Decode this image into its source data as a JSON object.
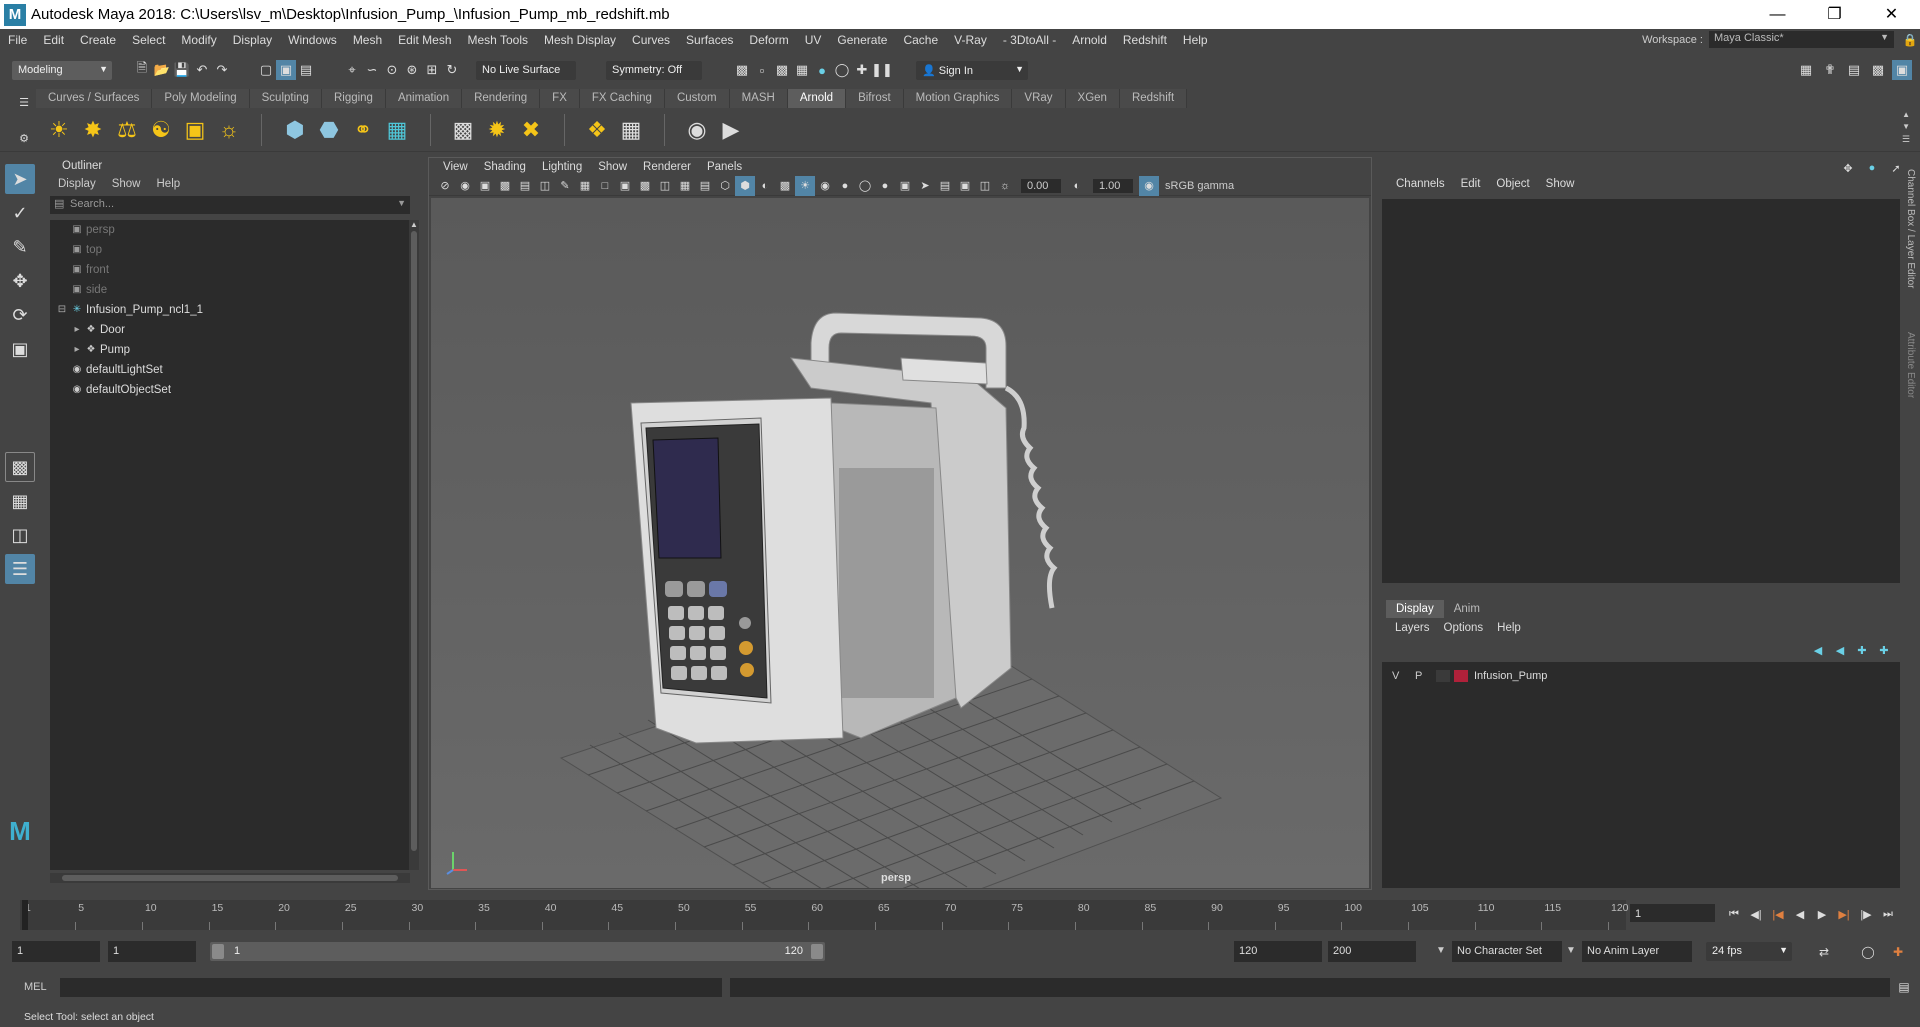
{
  "titlebar": {
    "title": "Autodesk Maya 2018: C:\\Users\\lsv_m\\Desktop\\Infusion_Pump_\\Infusion_Pump_mb_redshift.mb",
    "logo_letter": "M"
  },
  "menubar": {
    "items": [
      "File",
      "Edit",
      "Create",
      "Select",
      "Modify",
      "Display",
      "Windows",
      "Mesh",
      "Edit Mesh",
      "Mesh Tools",
      "Mesh Display",
      "Curves",
      "Surfaces",
      "Deform",
      "UV",
      "Generate",
      "Cache",
      "V-Ray",
      "- 3DtoAll -",
      "Arnold",
      "Redshift",
      "Help"
    ],
    "workspace_label": "Workspace :",
    "workspace_value": "Maya Classic*"
  },
  "statusline": {
    "mode": "Modeling",
    "live_surface": "No Live Surface",
    "symmetry": "Symmetry: Off",
    "sign_in": "Sign In"
  },
  "shelf": {
    "tabs": [
      "Curves / Surfaces",
      "Poly Modeling",
      "Sculpting",
      "Rigging",
      "Animation",
      "Rendering",
      "FX",
      "FX Caching",
      "Custom",
      "MASH",
      "Arnold",
      "Bifrost",
      "Motion Graphics",
      "VRay",
      "XGen",
      "Redshift"
    ],
    "active_tab": "Arnold"
  },
  "outliner": {
    "title": "Outliner",
    "menu": [
      "Display",
      "Show",
      "Help"
    ],
    "search_placeholder": "Search...",
    "items": [
      {
        "label": "persp",
        "dim": true,
        "indent": 1,
        "icon": "camera-icon"
      },
      {
        "label": "top",
        "dim": true,
        "indent": 1,
        "icon": "camera-icon"
      },
      {
        "label": "front",
        "dim": true,
        "indent": 1,
        "icon": "camera-icon"
      },
      {
        "label": "side",
        "dim": true,
        "indent": 1,
        "icon": "camera-icon"
      },
      {
        "label": "Infusion_Pump_ncl1_1",
        "dim": false,
        "indent": 1,
        "icon": "group-icon"
      },
      {
        "label": "Door",
        "dim": false,
        "indent": 2,
        "icon": "transform-icon"
      },
      {
        "label": "Pump",
        "dim": false,
        "indent": 2,
        "icon": "transform-icon"
      },
      {
        "label": "defaultLightSet",
        "dim": false,
        "indent": 1,
        "icon": "set-icon"
      },
      {
        "label": "defaultObjectSet",
        "dim": false,
        "indent": 1,
        "icon": "set-icon"
      }
    ]
  },
  "viewport": {
    "menu": [
      "View",
      "Shading",
      "Lighting",
      "Show",
      "Renderer",
      "Panels"
    ],
    "exposure": "0.00",
    "gamma": "1.00",
    "color_space": "sRGB gamma",
    "camera_label": "persp"
  },
  "channelbox": {
    "menu": [
      "Channels",
      "Edit",
      "Object",
      "Show"
    ],
    "side_tab_1": "Channel Box / Layer Editor",
    "side_tab_2": "Attribute Editor"
  },
  "layereditor": {
    "tabs": [
      "Display",
      "Anim"
    ],
    "active_tab": "Display",
    "menu": [
      "Layers",
      "Options",
      "Help"
    ],
    "layers": [
      {
        "v": "V",
        "p": "P",
        "name": "Infusion_Pump",
        "color": "#b0213a"
      }
    ]
  },
  "timeline": {
    "ticks": [
      "1",
      "5",
      "10",
      "15",
      "20",
      "25",
      "30",
      "35",
      "40",
      "45",
      "50",
      "55",
      "60",
      "65",
      "70",
      "75",
      "80",
      "85",
      "90",
      "95",
      "100",
      "105",
      "110",
      "115",
      "120"
    ],
    "current_frame": "1"
  },
  "range": {
    "start": "1",
    "playback_start": "1",
    "slider_start": "1",
    "slider_end": "120",
    "playback_end": "120",
    "end": "200",
    "character_set": "No Character Set",
    "anim_layer": "No Anim Layer",
    "fps": "24 fps"
  },
  "cmdline": {
    "label": "MEL"
  },
  "helpline": {
    "text": "Select Tool: select an object"
  },
  "colors": {
    "accent": "#5285a6",
    "panel": "#444444",
    "field": "#2b2b2b",
    "layer": "#b0213a"
  }
}
